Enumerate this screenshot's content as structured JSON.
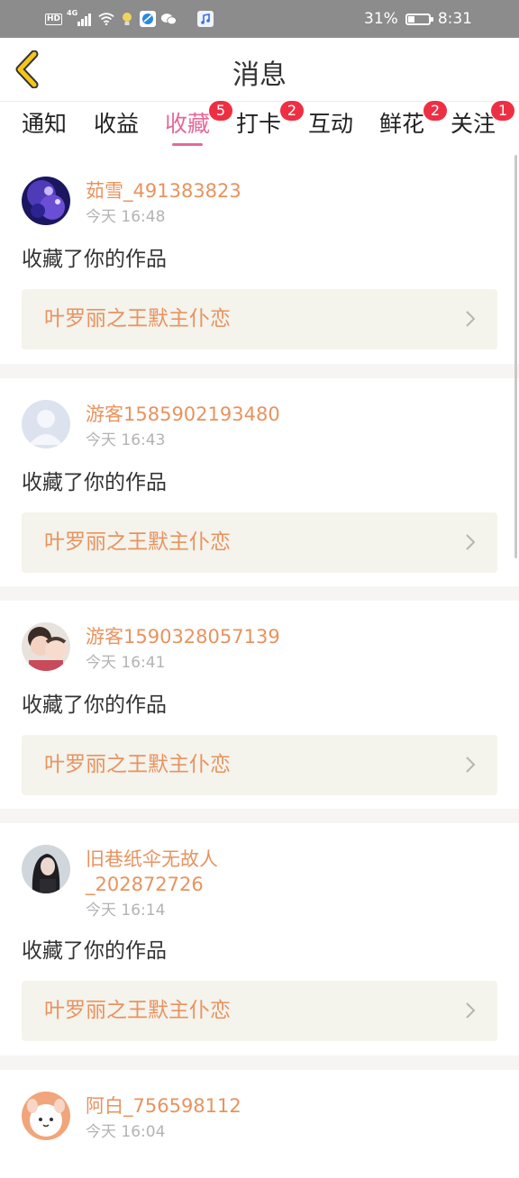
{
  "status_bar": {
    "hd": "HD",
    "network": "4G",
    "battery_percent": "31%",
    "battery_level": 0.31,
    "time": "8:31",
    "icons": [
      "hd-icon",
      "signal-icon",
      "wifi-icon",
      "bulb-icon",
      "browser-icon",
      "wechat-icon",
      "music-icon",
      "battery-icon"
    ]
  },
  "header": {
    "title": "消息",
    "back_icon": "chevron-left-icon",
    "accent_color": "#f5c518"
  },
  "tabs": [
    {
      "label": "通知",
      "badge": "",
      "active": false
    },
    {
      "label": "收益",
      "badge": "",
      "active": false
    },
    {
      "label": "收藏",
      "badge": "5",
      "active": true
    },
    {
      "label": "打卡",
      "badge": "2",
      "active": false
    },
    {
      "label": "互动",
      "badge": "",
      "active": false
    },
    {
      "label": "鲜花",
      "badge": "2",
      "active": false
    },
    {
      "label": "关注",
      "badge": "1",
      "active": false
    }
  ],
  "colors": {
    "active_tab": "#e4699a",
    "username": "#e8935f",
    "badge": "#ee2f43",
    "work_card_bg": "#f4f3ec"
  },
  "messages": [
    {
      "user": "茹雪_491383823",
      "time": "今天 16:48",
      "text": "收藏了你的作品",
      "work": "叶罗丽之王默主仆恋",
      "avatar": "purple-crystal-avatar"
    },
    {
      "user": "游客1585902193480",
      "time": "今天 16:43",
      "text": "收藏了你的作品",
      "work": "叶罗丽之王默主仆恋",
      "avatar": "default-person-avatar"
    },
    {
      "user": "游客1590328057139",
      "time": "今天 16:41",
      "text": "收藏了你的作品",
      "work": "叶罗丽之王默主仆恋",
      "avatar": "photo-avatar"
    },
    {
      "user": "旧巷纸伞无故人_202872726",
      "time": "今天 16:14",
      "text": "收藏了你的作品",
      "work": "叶罗丽之王默主仆恋",
      "avatar": "portrait-avatar"
    },
    {
      "user": "阿白_756598112",
      "time": "今天 16:04",
      "text": "",
      "work": "",
      "avatar": "cartoon-dog-avatar"
    }
  ]
}
